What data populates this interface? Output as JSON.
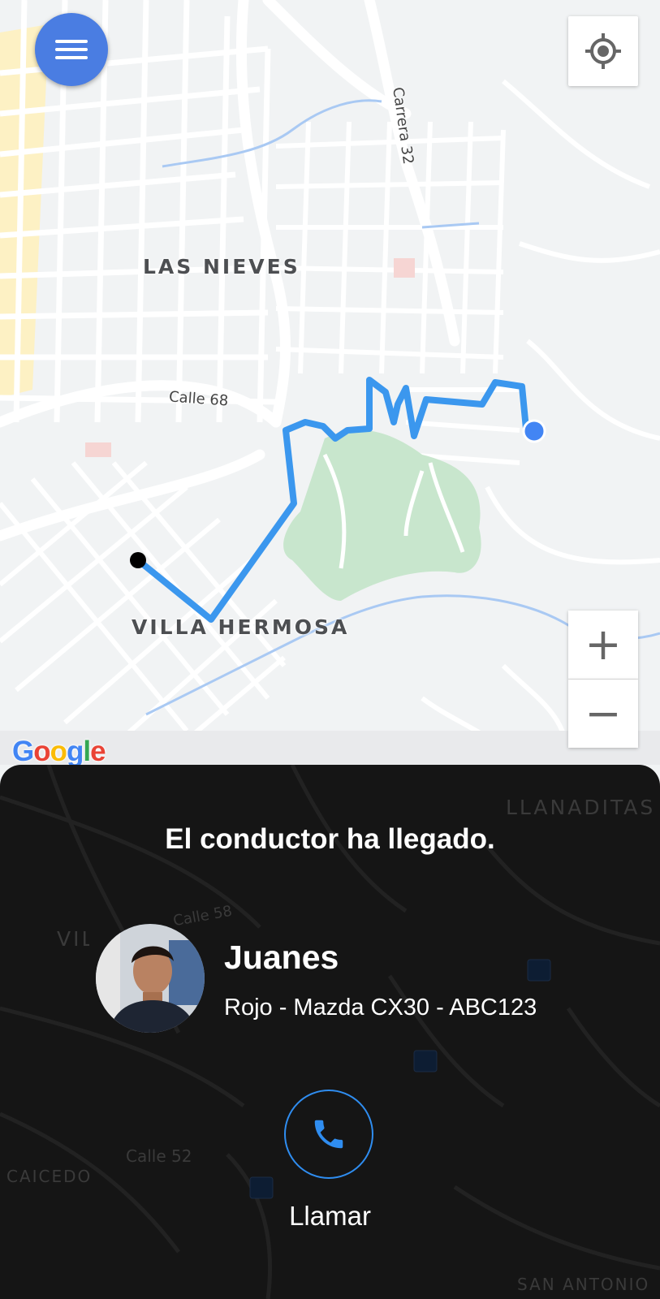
{
  "map": {
    "labels": {
      "las_nieves": "LAS NIEVES",
      "villa_hermosa": "VILLA HERMOSA",
      "calle_68": "Calle 68",
      "carrera_32": "Carrera 32",
      "llanaditas": "LLANADITAS",
      "calle_58": "Calle 58",
      "calle_52": "Calle 52",
      "caicedo": "CAICEDO",
      "san_antonio": "SAN ANTONIO",
      "villa_hermosa_partial": "VILLA HERMOSA"
    },
    "attribution": "Google",
    "route_color": "#3b97ee",
    "origin_color": "#4285f4",
    "destination_color": "#000000",
    "park_color": "#c8e6cd"
  },
  "controls": {
    "menu_icon": "hamburger-icon",
    "locate_icon": "crosshair-icon",
    "zoom_in": "+",
    "zoom_out": "−"
  },
  "panel": {
    "status": "El conductor ha llegado.",
    "driver": {
      "name": "Juanes",
      "vehicle": "Rojo - Mazda CX30 - ABC123"
    },
    "call_label": "Llamar",
    "call_icon": "phone-icon",
    "accent": "#2f8df0"
  }
}
